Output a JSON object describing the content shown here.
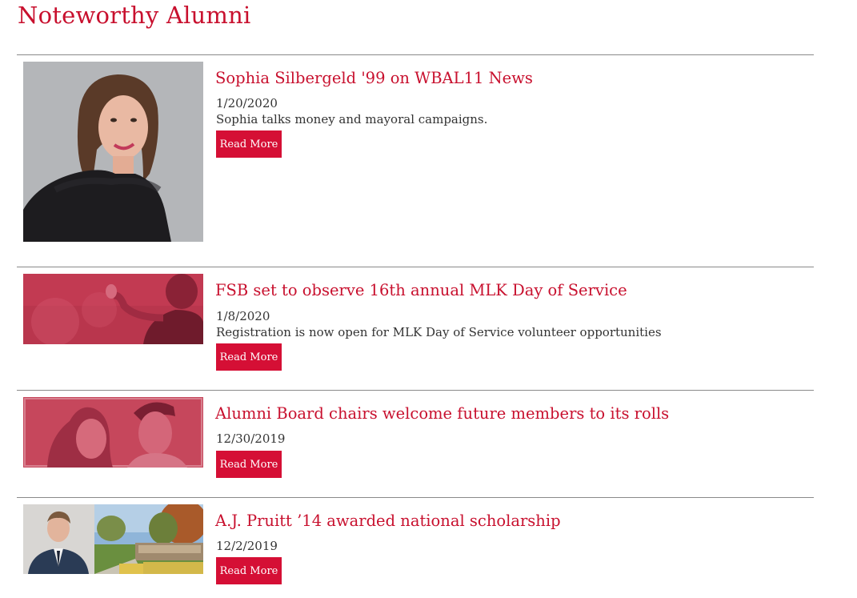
{
  "page": {
    "title": "Noteworthy Alumni"
  },
  "articles": [
    {
      "title": "Sophia Silbergeld '99 on WBAL11 News",
      "date": "1/20/2020",
      "description": "Sophia talks money and mayoral campaigns.",
      "button": "Read More"
    },
    {
      "title": "FSB set to observe 16th annual MLK Day of Service",
      "date": "1/8/2020",
      "description": "Registration is now open for MLK Day of Service volunteer opportunities",
      "button": "Read More"
    },
    {
      "title": "Alumni Board chairs welcome future members to its rolls",
      "date": "12/30/2019",
      "button": "Read More"
    },
    {
      "title": "A.J. Pruitt ’14 awarded national scholarship",
      "date": "12/2/2019",
      "button": "Read More"
    }
  ],
  "colors": {
    "accent": "#c8102e",
    "button": "#d50f35",
    "rule": "#8a8a8a"
  }
}
